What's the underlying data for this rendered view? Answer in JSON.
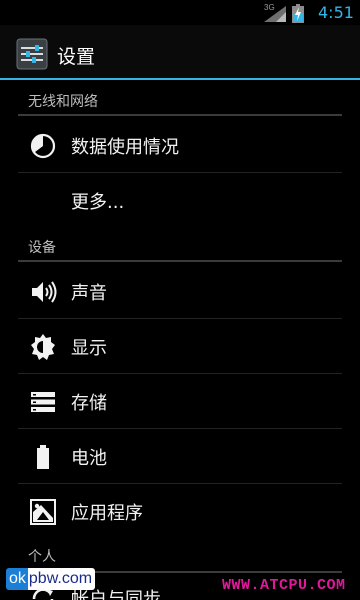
{
  "status_bar": {
    "network": "3G",
    "time": "4:51",
    "accent_color": "#33b5e5"
  },
  "action_bar": {
    "icon": "settings-sliders-icon",
    "title": "设置"
  },
  "sections": [
    {
      "header": "无线和网络",
      "items": [
        {
          "icon": "data-usage-icon",
          "label": "数据使用情况"
        },
        {
          "icon": "",
          "label": "更多..."
        }
      ]
    },
    {
      "header": "设备",
      "items": [
        {
          "icon": "speaker-icon",
          "label": "声音"
        },
        {
          "icon": "brightness-icon",
          "label": "显示"
        },
        {
          "icon": "storage-icon",
          "label": "存储"
        },
        {
          "icon": "battery-icon",
          "label": "电池"
        },
        {
          "icon": "apps-icon",
          "label": "应用程序"
        }
      ]
    },
    {
      "header": "个人",
      "items": [
        {
          "icon": "sync-icon",
          "label": "帐户与同步"
        }
      ]
    }
  ],
  "watermarks": {
    "left_prefix": "ok",
    "left_rest": "pbw.com",
    "right": "WWW.ATCPU.COM"
  }
}
